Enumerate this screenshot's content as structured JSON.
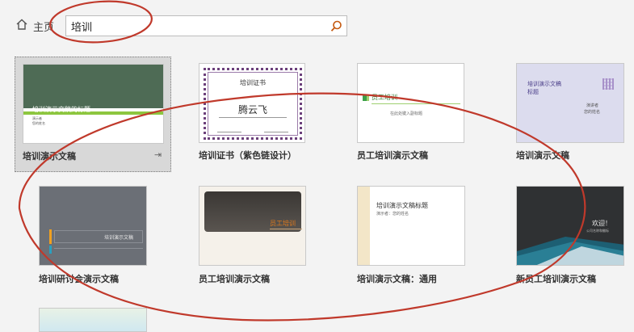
{
  "header": {
    "home_label": "主页",
    "search_value": "培训"
  },
  "templates": [
    {
      "caption": "培训演示文稿",
      "thumb": {
        "title": "培训演示文稿的标题",
        "sub1": "演示者",
        "sub2": "您的姓名"
      }
    },
    {
      "caption": "培训证书（紫色链设计）",
      "thumb": {
        "title": "培训证书",
        "name": "腾云飞"
      }
    },
    {
      "caption": "员工培训演示文稿",
      "thumb": {
        "title": "员工培训",
        "sub": "在此处键入副标题"
      }
    },
    {
      "caption": "培训演示文稿",
      "thumb": {
        "title1": "培训演示文稿",
        "title2": "标题",
        "sub1": "演讲者",
        "sub2": "您的姓名"
      }
    },
    {
      "caption": "培训研讨会演示文稿",
      "thumb": {
        "title": "培训演示文稿"
      }
    },
    {
      "caption": "员工培训演示文稿",
      "thumb": {
        "title": "员工培训"
      }
    },
    {
      "caption": "培训演示文稿：通用",
      "thumb": {
        "title": "培训演示文稿标题",
        "sub": "演示者：您的姓名"
      }
    },
    {
      "caption": "新员工培训演示文稿",
      "thumb": {
        "title": "欢迎！",
        "sub": "公司名称和徽标"
      }
    }
  ],
  "colors": {
    "annotation": "#c0392b",
    "selected_bg": "#d8d8d8",
    "green_slide": "#4e6b55",
    "purple_chain": "#6b3f7a",
    "gray_slide": "#6b6f76",
    "dark_slide": "#2f3133",
    "teal_accent": "#2a7f95"
  }
}
